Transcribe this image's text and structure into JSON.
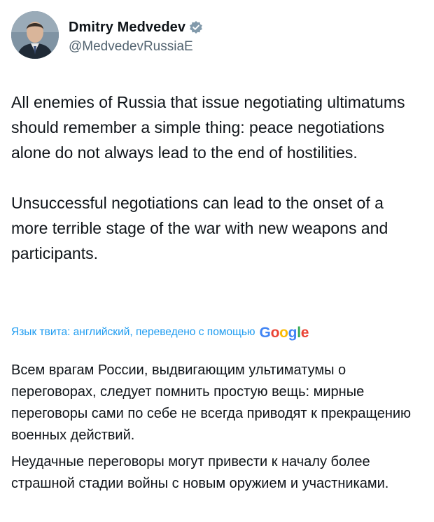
{
  "author": {
    "display_name": "Dmitry Medvedev",
    "handle": "@MedvedevRussiaE",
    "verified": true,
    "verified_badge_color": "#829aab"
  },
  "tweet": {
    "paragraphs": [
      "All enemies of Russia that issue negotiating ultimatums should remember a simple thing: peace negotiations alone do not always lead to the end of hostilities.",
      "Unsuccessful negotiations can lead to the onset of a more terrible stage of the war with new weapons and participants."
    ]
  },
  "translation": {
    "note": "Язык твита: английский, переведено с помощью",
    "provider_letters": [
      "G",
      "o",
      "o",
      "g",
      "l",
      "e"
    ],
    "provider_colors": [
      "#4285f4",
      "#ea4335",
      "#fbbc05",
      "#4285f4",
      "#34a853",
      "#ea4335"
    ],
    "paragraphs": [
      "Всем врагам России, выдвигающим ультиматумы о переговорах, следует помнить простую вещь: мирные переговоры сами по себе не всегда приводят к прекращению военных действий.",
      "Неудачные переговоры могут привести к началу более страшной стадии войны с новым оружием и участниками."
    ]
  },
  "colors": {
    "text": "#0f1419",
    "secondary": "#536471",
    "link": "#1d9bf0"
  }
}
